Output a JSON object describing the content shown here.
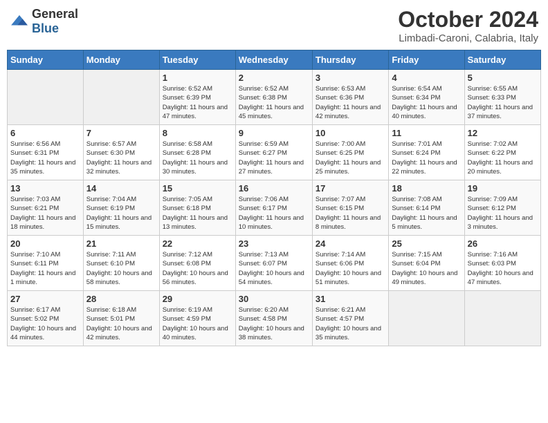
{
  "logo": {
    "general": "General",
    "blue": "Blue"
  },
  "header": {
    "month": "October 2024",
    "location": "Limbadi-Caroni, Calabria, Italy"
  },
  "weekdays": [
    "Sunday",
    "Monday",
    "Tuesday",
    "Wednesday",
    "Thursday",
    "Friday",
    "Saturday"
  ],
  "weeks": [
    [
      {
        "day": "",
        "details": ""
      },
      {
        "day": "",
        "details": ""
      },
      {
        "day": "1",
        "details": "Sunrise: 6:52 AM\nSunset: 6:39 PM\nDaylight: 11 hours and 47 minutes."
      },
      {
        "day": "2",
        "details": "Sunrise: 6:52 AM\nSunset: 6:38 PM\nDaylight: 11 hours and 45 minutes."
      },
      {
        "day": "3",
        "details": "Sunrise: 6:53 AM\nSunset: 6:36 PM\nDaylight: 11 hours and 42 minutes."
      },
      {
        "day": "4",
        "details": "Sunrise: 6:54 AM\nSunset: 6:34 PM\nDaylight: 11 hours and 40 minutes."
      },
      {
        "day": "5",
        "details": "Sunrise: 6:55 AM\nSunset: 6:33 PM\nDaylight: 11 hours and 37 minutes."
      }
    ],
    [
      {
        "day": "6",
        "details": "Sunrise: 6:56 AM\nSunset: 6:31 PM\nDaylight: 11 hours and 35 minutes."
      },
      {
        "day": "7",
        "details": "Sunrise: 6:57 AM\nSunset: 6:30 PM\nDaylight: 11 hours and 32 minutes."
      },
      {
        "day": "8",
        "details": "Sunrise: 6:58 AM\nSunset: 6:28 PM\nDaylight: 11 hours and 30 minutes."
      },
      {
        "day": "9",
        "details": "Sunrise: 6:59 AM\nSunset: 6:27 PM\nDaylight: 11 hours and 27 minutes."
      },
      {
        "day": "10",
        "details": "Sunrise: 7:00 AM\nSunset: 6:25 PM\nDaylight: 11 hours and 25 minutes."
      },
      {
        "day": "11",
        "details": "Sunrise: 7:01 AM\nSunset: 6:24 PM\nDaylight: 11 hours and 22 minutes."
      },
      {
        "day": "12",
        "details": "Sunrise: 7:02 AM\nSunset: 6:22 PM\nDaylight: 11 hours and 20 minutes."
      }
    ],
    [
      {
        "day": "13",
        "details": "Sunrise: 7:03 AM\nSunset: 6:21 PM\nDaylight: 11 hours and 18 minutes."
      },
      {
        "day": "14",
        "details": "Sunrise: 7:04 AM\nSunset: 6:19 PM\nDaylight: 11 hours and 15 minutes."
      },
      {
        "day": "15",
        "details": "Sunrise: 7:05 AM\nSunset: 6:18 PM\nDaylight: 11 hours and 13 minutes."
      },
      {
        "day": "16",
        "details": "Sunrise: 7:06 AM\nSunset: 6:17 PM\nDaylight: 11 hours and 10 minutes."
      },
      {
        "day": "17",
        "details": "Sunrise: 7:07 AM\nSunset: 6:15 PM\nDaylight: 11 hours and 8 minutes."
      },
      {
        "day": "18",
        "details": "Sunrise: 7:08 AM\nSunset: 6:14 PM\nDaylight: 11 hours and 5 minutes."
      },
      {
        "day": "19",
        "details": "Sunrise: 7:09 AM\nSunset: 6:12 PM\nDaylight: 11 hours and 3 minutes."
      }
    ],
    [
      {
        "day": "20",
        "details": "Sunrise: 7:10 AM\nSunset: 6:11 PM\nDaylight: 11 hours and 1 minute."
      },
      {
        "day": "21",
        "details": "Sunrise: 7:11 AM\nSunset: 6:10 PM\nDaylight: 10 hours and 58 minutes."
      },
      {
        "day": "22",
        "details": "Sunrise: 7:12 AM\nSunset: 6:08 PM\nDaylight: 10 hours and 56 minutes."
      },
      {
        "day": "23",
        "details": "Sunrise: 7:13 AM\nSunset: 6:07 PM\nDaylight: 10 hours and 54 minutes."
      },
      {
        "day": "24",
        "details": "Sunrise: 7:14 AM\nSunset: 6:06 PM\nDaylight: 10 hours and 51 minutes."
      },
      {
        "day": "25",
        "details": "Sunrise: 7:15 AM\nSunset: 6:04 PM\nDaylight: 10 hours and 49 minutes."
      },
      {
        "day": "26",
        "details": "Sunrise: 7:16 AM\nSunset: 6:03 PM\nDaylight: 10 hours and 47 minutes."
      }
    ],
    [
      {
        "day": "27",
        "details": "Sunrise: 6:17 AM\nSunset: 5:02 PM\nDaylight: 10 hours and 44 minutes."
      },
      {
        "day": "28",
        "details": "Sunrise: 6:18 AM\nSunset: 5:01 PM\nDaylight: 10 hours and 42 minutes."
      },
      {
        "day": "29",
        "details": "Sunrise: 6:19 AM\nSunset: 4:59 PM\nDaylight: 10 hours and 40 minutes."
      },
      {
        "day": "30",
        "details": "Sunrise: 6:20 AM\nSunset: 4:58 PM\nDaylight: 10 hours and 38 minutes."
      },
      {
        "day": "31",
        "details": "Sunrise: 6:21 AM\nSunset: 4:57 PM\nDaylight: 10 hours and 35 minutes."
      },
      {
        "day": "",
        "details": ""
      },
      {
        "day": "",
        "details": ""
      }
    ]
  ]
}
